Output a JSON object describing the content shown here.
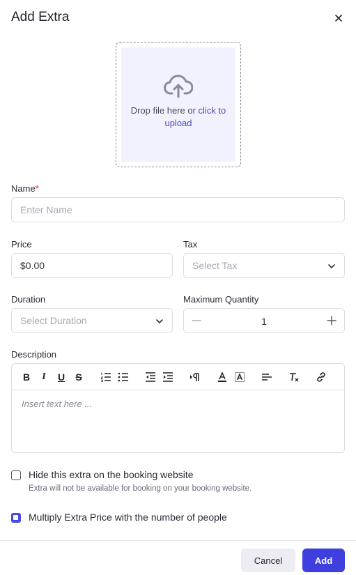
{
  "modal": {
    "title": "Add Extra"
  },
  "dropzone": {
    "text": "Drop file here or ",
    "link": "click to upload"
  },
  "fields": {
    "name": {
      "label": "Name",
      "required_mark": "*",
      "placeholder": "Enter Name"
    },
    "price": {
      "label": "Price",
      "value": "$0.00"
    },
    "tax": {
      "label": "Tax",
      "placeholder": "Select Tax"
    },
    "duration": {
      "label": "Duration",
      "placeholder": "Select Duration"
    },
    "max_quantity": {
      "label": "Maximum Quantity",
      "value": "1"
    },
    "description": {
      "label": "Description",
      "placeholder": "Insert text here ..."
    }
  },
  "toolbar_icons": [
    "bold-icon",
    "italic-icon",
    "underline-icon",
    "strikethrough-icon",
    "ordered-list-icon",
    "bullet-list-icon",
    "outdent-icon",
    "indent-icon",
    "text-direction-icon",
    "text-color-icon",
    "background-color-icon",
    "align-icon",
    "clear-format-icon",
    "link-icon"
  ],
  "toolbar_labels": {
    "bold": "B",
    "italic": "I",
    "underline": "U",
    "strike": "S"
  },
  "options": {
    "hide": {
      "label": "Hide this extra on the booking website",
      "sub": "Extra will not be available for booking on your booking website.",
      "checked": false
    },
    "multiply": {
      "label": "Multiply Extra Price with the number of people",
      "checked": true
    }
  },
  "footer": {
    "cancel": "Cancel",
    "add": "Add"
  },
  "colors": {
    "accent": "#3f3fe0",
    "dropzone_bg": "#f2f2fe",
    "link": "#4a4ac6",
    "required": "#e02424"
  }
}
